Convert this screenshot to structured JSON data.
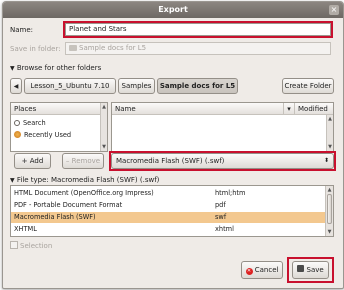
{
  "window": {
    "title": "Export",
    "close_glyph": "×"
  },
  "name_label": "Name:",
  "name_value": "Planet and Stars",
  "save_in_label": "Save in folder:",
  "save_in_value": "Sample docs for L5",
  "browse_label": "Browse for other folders",
  "path_buttons": [
    "Lesson_5_Ubuntu 7.10",
    "Samples",
    "Sample docs for L5"
  ],
  "create_folder_label": "Create Folder",
  "places": {
    "header": "Places",
    "items": [
      {
        "icon": "search-icon",
        "label": "Search"
      },
      {
        "icon": "recent-icon",
        "label": "Recently Used"
      }
    ]
  },
  "files": {
    "col_name": "Name",
    "col_modified": "Modified"
  },
  "add_label": "Add",
  "remove_label": "Remove",
  "filter_value": "Macromedia Flash (SWF) (.swf)",
  "file_type": {
    "label": "File type: Macromedia Flash (SWF) (.swf)",
    "rows": [
      {
        "name": "HTML Document (OpenOffice.org Impress)",
        "ext": "html;htm"
      },
      {
        "name": "PDF - Portable Document Format",
        "ext": "pdf"
      },
      {
        "name": "Macromedia Flash (SWF)",
        "ext": "swf"
      },
      {
        "name": "XHTML",
        "ext": "xhtml"
      }
    ]
  },
  "selection_label": "Selection",
  "cancel_label": "Cancel",
  "save_label": "Save",
  "colors": {
    "highlight": "#c8102e",
    "selected_row": "#f3c88f",
    "title_bar": "#7a7570"
  }
}
